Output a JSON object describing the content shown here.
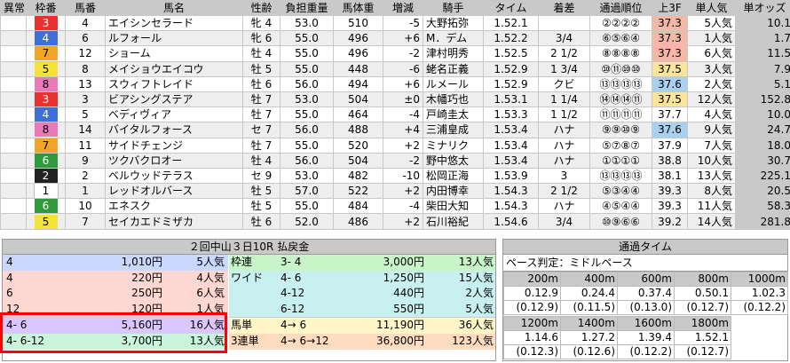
{
  "table": {
    "headers": [
      "異常",
      "枠番",
      "馬番",
      "馬名",
      "性齢",
      "負担重量",
      "馬体重",
      "増減",
      "騎手",
      "タイム",
      "着差",
      "通過順位",
      "上3F",
      "単人気",
      "単オッズ"
    ],
    "rows": [
      {
        "wakuban": "3",
        "umaban": "4",
        "name": "エイシンセラード",
        "sexage": "牝 4",
        "weight": "53.0",
        "body": "510",
        "diff": "-5",
        "jockey": "大野拓弥",
        "time": "1.52.1",
        "margin": "",
        "passing": "②②②②",
        "last3f": "37.3",
        "pop": "5人気",
        "odds": "10.1",
        "wcolor": "#e8322f",
        "wtext": "#ffffff",
        "l3color": "#f5b8a8"
      },
      {
        "wakuban": "4",
        "umaban": "6",
        "name": "ルフォール",
        "sexage": "牝 6",
        "weight": "55.0",
        "body": "496",
        "diff": "+6",
        "jockey": "M．デム",
        "time": "1.52.2",
        "margin": "3/4",
        "passing": "⑥⑤⑥④",
        "last3f": "37.3",
        "pop": "1人気",
        "odds": "1.7",
        "wcolor": "#3d6fd6",
        "wtext": "#ffffff",
        "l3color": "#f5b8a8"
      },
      {
        "wakuban": "7",
        "umaban": "12",
        "name": "ショーム",
        "sexage": "牡 4",
        "weight": "55.0",
        "body": "496",
        "diff": "-2",
        "jockey": "津村明秀",
        "time": "1.52.5",
        "margin": "2 1/2",
        "passing": "⑧⑧⑧⑧",
        "last3f": "37.3",
        "pop": "6人気",
        "odds": "11.5",
        "wcolor": "#f0a52a",
        "wtext": "#000000",
        "l3color": "#f5b8a8"
      },
      {
        "wakuban": "5",
        "umaban": "8",
        "name": "メイショウエイコウ",
        "sexage": "牡 5",
        "weight": "55.0",
        "body": "448",
        "diff": "-6",
        "jockey": "蛯名正義",
        "time": "1.52.9",
        "margin": "1 3/4",
        "passing": "⑩⑪⑩⑩",
        "last3f": "37.5",
        "pop": "3人気",
        "odds": "7.9",
        "wcolor": "#f2e23a",
        "wtext": "#000000",
        "l3color": "#fce49a"
      },
      {
        "wakuban": "8",
        "umaban": "13",
        "name": "スウィフトレイド",
        "sexage": "牡 6",
        "weight": "56.0",
        "body": "494",
        "diff": "+6",
        "jockey": "ルメール",
        "time": "1.52.9",
        "margin": "クビ",
        "passing": "⑬⑬⑬⑬",
        "last3f": "37.6",
        "pop": "2人気",
        "odds": "5.1",
        "wcolor": "#e87ab8",
        "wtext": "#000000",
        "l3color": "#a9d1ef"
      },
      {
        "wakuban": "3",
        "umaban": "3",
        "name": "ビアシングステア",
        "sexage": "牡 7",
        "weight": "53.0",
        "body": "504",
        "diff": "±0",
        "jockey": "木幡巧也",
        "time": "1.53.1",
        "margin": "1 1/4",
        "passing": "⑭⑭⑭⑪",
        "last3f": "37.5",
        "pop": "12人気",
        "odds": "152.8",
        "wcolor": "#e8322f",
        "wtext": "#ffffff",
        "l3color": "#fce49a"
      },
      {
        "wakuban": "4",
        "umaban": "5",
        "name": "ベディヴィア",
        "sexage": "牡 7",
        "weight": "55.0",
        "body": "464",
        "diff": "-4",
        "jockey": "戸崎圭太",
        "time": "1.53.3",
        "margin": "1 1/2",
        "passing": "⑪⑪⑪⑪",
        "last3f": "37.7",
        "pop": "4人気",
        "odds": "10.0",
        "wcolor": "#3d6fd6",
        "wtext": "#ffffff",
        "l3color": ""
      },
      {
        "wakuban": "8",
        "umaban": "14",
        "name": "バイタルフォース",
        "sexage": "セ 7",
        "weight": "56.0",
        "body": "488",
        "diff": "+4",
        "jockey": "三浦皇成",
        "time": "1.53.4",
        "margin": "ハナ",
        "passing": "⑨⑨⑩⑨",
        "last3f": "37.6",
        "pop": "9人気",
        "odds": "24.7",
        "wcolor": "#e87ab8",
        "wtext": "#000000",
        "l3color": "#a9d1ef"
      },
      {
        "wakuban": "7",
        "umaban": "11",
        "name": "サイドチェンジ",
        "sexage": "牡 7",
        "weight": "55.0",
        "body": "520",
        "diff": "+2",
        "jockey": "ミナリク",
        "time": "1.53.4",
        "margin": "ハナ",
        "passing": "⑤⑦⑧⑦",
        "last3f": "37.9",
        "pop": "7人気",
        "odds": "18.0",
        "wcolor": "#f0a52a",
        "wtext": "#000000",
        "l3color": ""
      },
      {
        "wakuban": "6",
        "umaban": "9",
        "name": "ツクバクロオー",
        "sexage": "牡 4",
        "weight": "56.0",
        "body": "504",
        "diff": "-2",
        "jockey": "野中悠太",
        "time": "1.53.4",
        "margin": "ハナ",
        "passing": "①①①①",
        "last3f": "38.8",
        "pop": "10人気",
        "odds": "30.7",
        "wcolor": "#2e9a3c",
        "wtext": "#ffffff",
        "l3color": ""
      },
      {
        "wakuban": "2",
        "umaban": "2",
        "name": "ベルウッドテラス",
        "sexage": "セ 9",
        "weight": "53.0",
        "body": "482",
        "diff": "-10",
        "jockey": "松岡正海",
        "time": "1.53.9",
        "margin": "3",
        "passing": "⑬⑬⑬⑬",
        "last3f": "38.1",
        "pop": "13人気",
        "odds": "225.1",
        "wcolor": "#222222",
        "wtext": "#ffffff",
        "l3color": ""
      },
      {
        "wakuban": "1",
        "umaban": "1",
        "name": "レッドオルバース",
        "sexage": "牡 5",
        "weight": "57.0",
        "body": "522",
        "diff": "+2",
        "jockey": "内田博幸",
        "time": "1.54.3",
        "margin": "2 1/2",
        "passing": "⑤③④④",
        "last3f": "39.3",
        "pop": "8人気",
        "odds": "20.5",
        "wcolor": "#ffffff",
        "wtext": "#000000",
        "l3color": ""
      },
      {
        "wakuban": "6",
        "umaban": "10",
        "name": "エネスク",
        "sexage": "牡 5",
        "weight": "55.0",
        "body": "484",
        "diff": "-4",
        "jockey": "柴田大知",
        "time": "1.54.3",
        "margin": "ハナ",
        "passing": "④⑤④④",
        "last3f": "39.3",
        "pop": "11人気",
        "odds": "58.3",
        "wcolor": "#2e9a3c",
        "wtext": "#ffffff",
        "l3color": ""
      },
      {
        "wakuban": "5",
        "umaban": "7",
        "name": "セイカエドミザカ",
        "sexage": "牡 6",
        "weight": "52.0",
        "body": "486",
        "diff": "+2",
        "jockey": "石川裕紀",
        "time": "1.54.6",
        "margin": "3/4",
        "passing": "⑩⑨⑥⑥",
        "last3f": "39.2",
        "pop": "14人気",
        "odds": "281.8",
        "wcolor": "#f2e23a",
        "wtext": "#000000",
        "l3color": ""
      }
    ]
  },
  "payout": {
    "title": "２回中山３日10R 払戻金",
    "left": [
      {
        "combo": "4",
        "amount": "1,010円",
        "pop": "5人気",
        "bg": "#c8d8ff"
      },
      {
        "combo": "4",
        "amount": "220円",
        "pop": "4人気",
        "bg": "#ffd7d2"
      },
      {
        "combo": "6",
        "amount": "250円",
        "pop": "6人気",
        "bg": "#ffd7d2"
      },
      {
        "combo": "12",
        "amount": "120円",
        "pop": "1人気",
        "bg": "#ffd7d2"
      },
      {
        "combo": "4- 6",
        "amount": "5,160円",
        "pop": "16人気",
        "bg": "#dcc6ff"
      },
      {
        "combo": "4- 6-12",
        "amount": "3,700円",
        "pop": "13人気",
        "bg": "#c8f5dc"
      }
    ],
    "right": [
      {
        "type": "枠連",
        "combo": "3- 4",
        "amount": "3,000円",
        "pop": "13人気",
        "bg": "#c8f5c8"
      },
      {
        "type": "ワイド",
        "combo": "4- 6",
        "amount": "1,250円",
        "pop": "15人気",
        "bg": "#c8f0f0"
      },
      {
        "type": "",
        "combo": "4-12",
        "amount": "440円",
        "pop": "2人気",
        "bg": "#c8f0f0"
      },
      {
        "type": "",
        "combo": "6-12",
        "amount": "550円",
        "pop": "5人気",
        "bg": "#c8f0f0"
      },
      {
        "type": "馬単",
        "combo": "4→ 6",
        "amount": "11,190円",
        "pop": "36人気",
        "bg": "#fff6c8"
      },
      {
        "type": "3連単",
        "combo": "4→ 6→12",
        "amount": "36,800円",
        "pop": "123人気",
        "bg": "#ffdcc0"
      }
    ]
  },
  "passing_time": {
    "title": "通過タイム",
    "pace": "ペース判定：ミドルペース",
    "row1": {
      "dist": [
        "200m",
        "400m",
        "600m",
        "800m",
        "1000m"
      ],
      "time": [
        "0.12.9",
        "0.24.4",
        "0.37.4",
        "0.50.1",
        "1.02.3"
      ],
      "split": [
        "(0.12.9)",
        "(0.11.5)",
        "(0.13.0)",
        "(0.12.7)",
        "(0.12.2)"
      ]
    },
    "row2": {
      "dist": [
        "1200m",
        "1400m",
        "1600m",
        "1800m"
      ],
      "time": [
        "1.14.6",
        "1.27.2",
        "1.39.4",
        "1.52.1"
      ],
      "split": [
        "(0.12.3)",
        "(0.12.6)",
        "(0.12.2)",
        "(0.12.7)"
      ]
    }
  }
}
